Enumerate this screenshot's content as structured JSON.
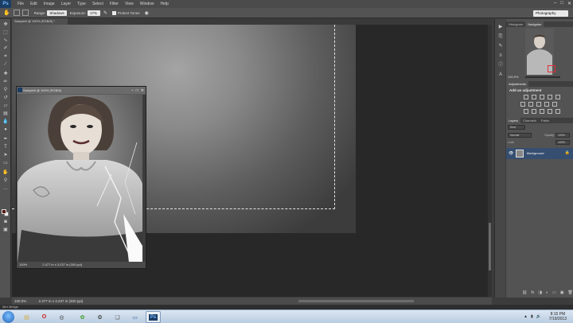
{
  "app": {
    "logo": "Ps"
  },
  "menu": [
    "File",
    "Edit",
    "Image",
    "Layer",
    "Type",
    "Select",
    "Filter",
    "View",
    "Window",
    "Help"
  ],
  "window_controls": [
    "–",
    "□",
    "✕"
  ],
  "options_bar": {
    "range_label": "Range:",
    "range_value": "Shadows",
    "exposure_label": "Exposure:",
    "exposure_value": "17%",
    "protect_tones": "Protect Tones"
  },
  "workspace": "Photography",
  "document": {
    "tab_title": "Sample6 @ 100% (RGB/8) *",
    "zoom": "100.0%",
    "size_info": "2.477 in x 3.237 in (300 ppi)"
  },
  "float_window": {
    "title": "Sample6 @ 100% (RGB/8)",
    "zoom": "100%",
    "size_info": "2.477 in x 3.237 in (300 ppi)"
  },
  "panels": {
    "top_tabs": [
      "Histogram",
      "Navigator"
    ],
    "navigator_zoom": "100.0%",
    "adjust_tab": "Adjustments",
    "adjust_title": "Add an adjustment",
    "layers_tabs": [
      "Layers",
      "Channels",
      "Paths"
    ],
    "kind": "Kind",
    "blend": "Normal",
    "opacity_label": "Opacity:",
    "opacity": "100%",
    "lock_label": "Lock:",
    "fill": "100%",
    "layer_name": "Background"
  },
  "mini_bridge": "Mini Bridge",
  "taskbar": {
    "apps": [
      {
        "name": "explorer",
        "glyph": "▤",
        "color": "#d8a93a"
      },
      {
        "name": "opera",
        "glyph": "O",
        "color": "#cc1f1f"
      },
      {
        "name": "media",
        "glyph": "◎",
        "color": "#333333"
      },
      {
        "name": "green-app",
        "glyph": "✿",
        "color": "#3c9a2c"
      },
      {
        "name": "steam",
        "glyph": "⚙",
        "color": "#222222"
      },
      {
        "name": "chat",
        "glyph": "❏",
        "color": "#555555"
      },
      {
        "name": "monitor",
        "glyph": "▭",
        "color": "#2c5d9c"
      },
      {
        "name": "photoshop",
        "glyph": "Ps",
        "color": "#1b3d63"
      }
    ],
    "time": "8:15 PM",
    "date": "7/19/2013"
  }
}
